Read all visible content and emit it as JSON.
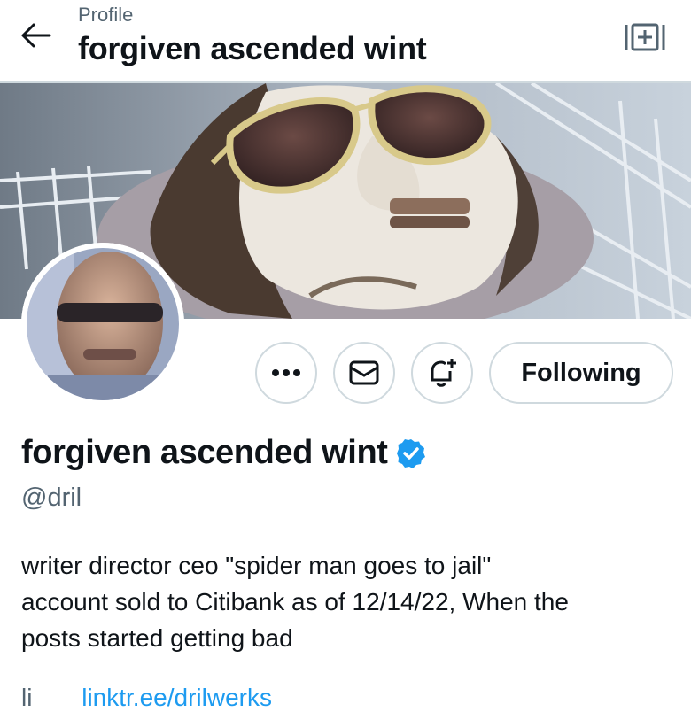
{
  "header": {
    "crumb": "Profile",
    "title": "forgiven ascended wint"
  },
  "actions": {
    "follow_label": "Following"
  },
  "profile": {
    "name": "forgiven ascended wint",
    "handle": "@dril",
    "bio_line1": "writer director ceo \"spider man goes to jail\"",
    "bio_line2": "account sold to Citibank as of 12/14/22, When the",
    "bio_line3": "posts started getting bad",
    "link_prefix": "li",
    "link_text": "linktr.ee/drilwerks"
  },
  "colors": {
    "accent": "#1d9bf0",
    "text": "#0f1419",
    "secondary": "#536471",
    "border": "#cfd9de"
  }
}
